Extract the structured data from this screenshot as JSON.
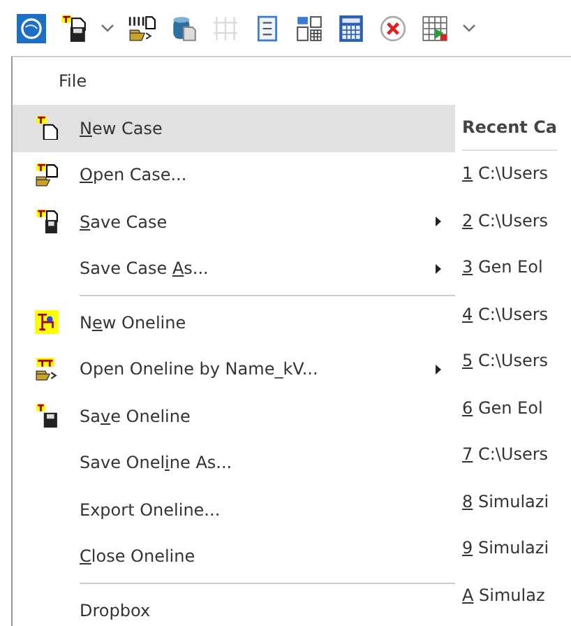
{
  "toolbar": [
    {
      "kind": "globe",
      "disabled": false
    },
    {
      "kind": "case-save",
      "disabled": false
    },
    {
      "kind": "dropdown",
      "disabled": false
    },
    {
      "kind": "aux-open",
      "disabled": false
    },
    {
      "kind": "database",
      "disabled": false
    },
    {
      "kind": "sliders",
      "disabled": true
    },
    {
      "kind": "log",
      "disabled": false
    },
    {
      "kind": "layout",
      "disabled": false
    },
    {
      "kind": "calculator",
      "disabled": false
    },
    {
      "kind": "cancel",
      "disabled": false
    },
    {
      "kind": "grid",
      "disabled": false
    },
    {
      "kind": "dropdown",
      "disabled": false
    }
  ],
  "menu": {
    "title": "File",
    "items": [
      {
        "kind": "item",
        "access_key": "N",
        "text_after": "ew Case",
        "submenu": false,
        "selected": true
      },
      {
        "kind": "item",
        "access_key": "O",
        "text_after": "pen Case...",
        "submenu": false,
        "selected": false
      },
      {
        "kind": "item",
        "access_key": "S",
        "text_after": "ave Case",
        "submenu": true,
        "selected": false
      },
      {
        "kind": "item",
        "text_before": "Save Case ",
        "access_key": "A",
        "text_after": "s...",
        "submenu": true,
        "selected": false
      },
      {
        "kind": "separator"
      },
      {
        "kind": "item",
        "text_before": "N",
        "access_key": "e",
        "text_after": "w Oneline",
        "submenu": false,
        "selected": false
      },
      {
        "kind": "item",
        "text_before": "Open Oneline by Name_kV...",
        "submenu": true,
        "selected": false
      },
      {
        "kind": "item",
        "text_before": "Sa",
        "access_key": "v",
        "text_after": "e Oneline",
        "submenu": false,
        "selected": false
      },
      {
        "kind": "item",
        "text_before": "Save Onel",
        "access_key": "i",
        "text_after": "ne As...",
        "submenu": false,
        "selected": false
      },
      {
        "kind": "item",
        "text_before": "Export Oneline...",
        "submenu": false,
        "selected": false
      },
      {
        "kind": "item",
        "access_key": "C",
        "text_after": "lose Oneline",
        "submenu": false,
        "selected": false
      },
      {
        "kind": "separator"
      },
      {
        "kind": "item",
        "text_before": "Dropbox",
        "submenu": false,
        "selected": false
      }
    ]
  },
  "recent": {
    "title": "Recent Ca",
    "items": [
      {
        "access_key": "1",
        "text": " C:\\Users"
      },
      {
        "access_key": "2",
        "text": " C:\\Users"
      },
      {
        "access_key": "3",
        "text": " Gen Eol"
      },
      {
        "access_key": "4",
        "text": " C:\\Users"
      },
      {
        "access_key": "5",
        "text": " C:\\Users"
      },
      {
        "access_key": "6",
        "text": " Gen Eol"
      },
      {
        "access_key": "7",
        "text": " C:\\Users"
      },
      {
        "access_key": "8",
        "text": " Simulazi"
      },
      {
        "access_key": "9",
        "text": " Simulazi"
      },
      {
        "access_key": "A",
        "text": " Simulaz"
      }
    ]
  }
}
